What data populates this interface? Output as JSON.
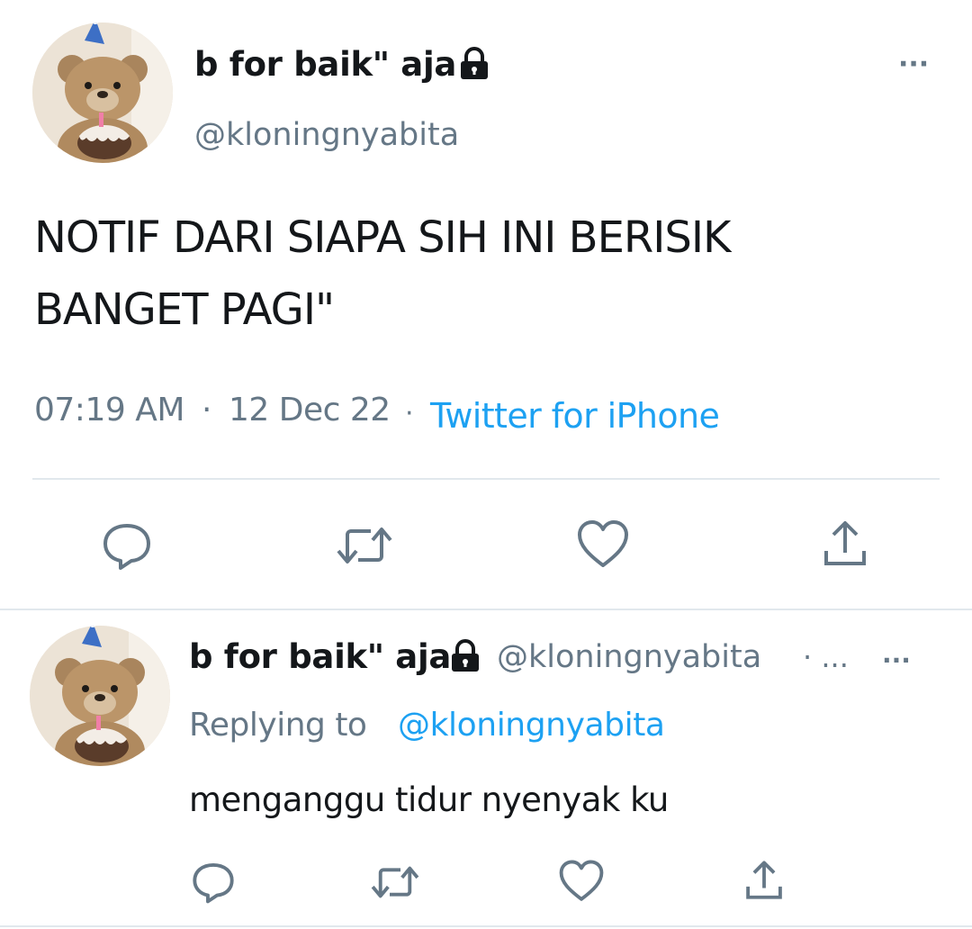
{
  "main_tweet": {
    "author_name": "b for baik\" aja",
    "author_handle": "@kloningnyabita",
    "text_line1": "NOTIF DARI SIAPA SIH INI BERISIK",
    "text_line2": "BANGET PAGI\"",
    "time": "07:19 AM",
    "sep1": "·",
    "date": "12 Dec 22",
    "sep2": "·",
    "source": "Twitter for iPhone",
    "more": "···"
  },
  "reply_tweet": {
    "author_name": "b for baik\" aja",
    "author_handle": "@kloningnyabita",
    "meta_suffix": "· ...",
    "replying_prefix": "Replying to",
    "replying_handle": "@kloningnyabita",
    "text": "menganggu tidur nyenyak ku",
    "more": "···"
  },
  "icons": {
    "lock": "lock-icon",
    "reply": "reply-icon",
    "retweet": "retweet-icon",
    "like": "heart-icon",
    "share": "share-icon"
  },
  "colors": {
    "link": "#1da1f2",
    "secondary_text": "#657786",
    "divider": "#e1e8ed"
  }
}
